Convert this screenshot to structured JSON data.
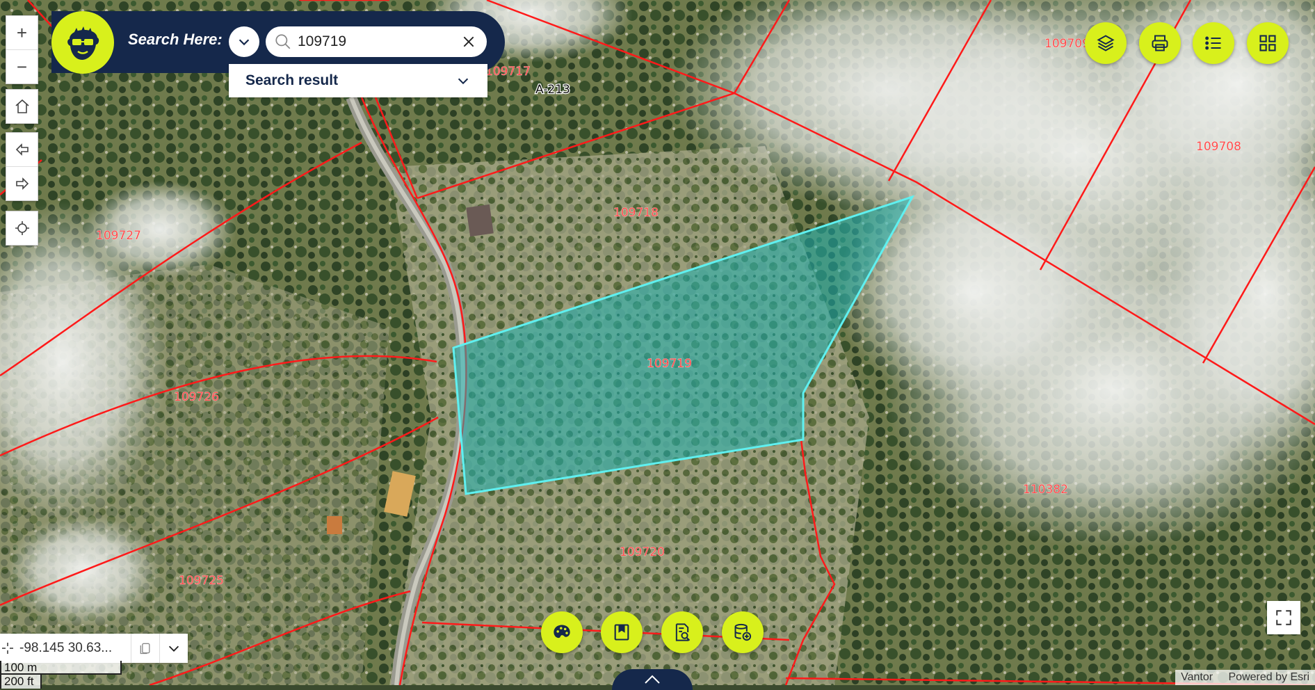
{
  "search": {
    "label": "Search Here:",
    "value": "109719",
    "result_label": "Search result"
  },
  "map": {
    "parcels": [
      "109717",
      "109709",
      "109708",
      "109718",
      "109727",
      "109719",
      "109726",
      "110382",
      "109720",
      "109725"
    ],
    "road_label": "A-213"
  },
  "coordinates": {
    "text": "-98.145 30.63..."
  },
  "scale": {
    "metric": "100 m",
    "imperial": "200 ft"
  },
  "attribution": {
    "provider": "Vantor",
    "powered_by": "Powered by Esri"
  },
  "colors": {
    "accent": "#d8f01c",
    "navy": "#15284b",
    "parcel_line": "#ff1a1a",
    "selection_fill": "#1fb3b3",
    "selection_stroke": "#5ff0f0"
  },
  "icons": {
    "top_right": [
      "layers-icon",
      "print-icon",
      "list-icon",
      "grid-icon"
    ],
    "bottom": [
      "palette-icon",
      "bookmark-icon",
      "search-document-icon",
      "add-data-icon"
    ]
  }
}
